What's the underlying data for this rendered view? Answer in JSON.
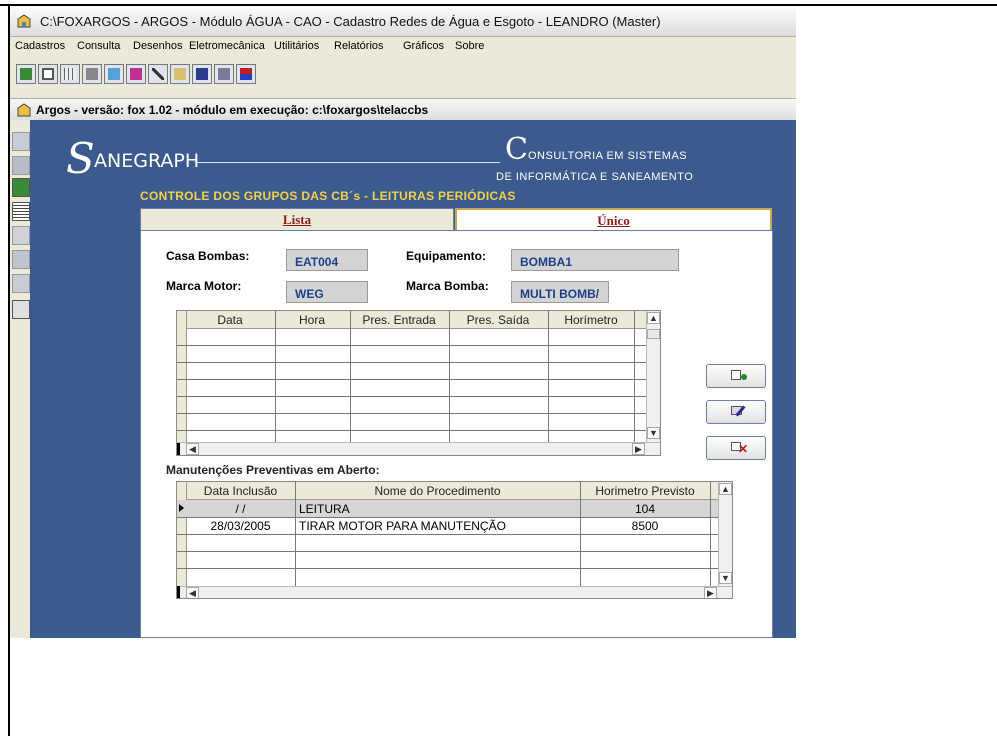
{
  "window": {
    "title": "C:\\FOXARGOS - ARGOS - Módulo ÁGUA - CAO - Cadastro Redes de Água e Esgoto - LEANDRO (Master)"
  },
  "menu": [
    "Cadastros",
    "Consulta",
    "Desenhos",
    "Eletromecânica",
    "Utilitários",
    "Relatórios",
    "Gráficos",
    "Sobre"
  ],
  "toolbar_icons": [
    "exit-icon",
    "form-icon",
    "table-icon",
    "edit-icon",
    "screen-icon",
    "window-icon",
    "tools-icon",
    "copy-icon",
    "save-icon",
    "report-icon",
    "sort-icon"
  ],
  "subbar": {
    "text": "Argos - versão: fox 1.02 - módulo em execução: c:\\foxargos\\telaccbs"
  },
  "side_icons": [
    "new-record-icon",
    "disk-icon",
    "exit-icon",
    "list-icon",
    "delete-icon",
    "undo-icon",
    "approve-icon",
    "print-icon"
  ],
  "logo": {
    "s": "S",
    "name": "ANEGRAPH",
    "c": "C",
    "line1": "ONSULTORIA EM SISTEMAS",
    "line2": "DE INFORMÁTICA E SANEAMENTO"
  },
  "heading": "CONTROLE DOS GRUPOS DAS CB´s - LEITURAS PERIÓDICAS",
  "tabs": {
    "lista": "Lista",
    "unico": "Único"
  },
  "fields": {
    "casa_bombas_label": "Casa Bombas:",
    "casa_bombas": "EAT004",
    "equipamento_label": "Equipamento:",
    "equipamento": "BOMBA1",
    "marca_motor_label": "Marca Motor:",
    "marca_motor": "WEG",
    "marca_bomba_label": "Marca Bomba:",
    "marca_bomba": "MULTI BOMB/"
  },
  "readings": {
    "columns": [
      "Data",
      "Hora",
      "Pres. Entrada",
      "Pres. Saída",
      "Horímetro"
    ]
  },
  "maint": {
    "title": "Manutenções Preventivas em Aberto:",
    "columns": [
      "Data Inclusão",
      "Nome do Procedimento",
      "Horimetro Previsto"
    ],
    "rows": [
      {
        "date": " / /",
        "proc": "LEITURA",
        "hor": "104"
      },
      {
        "date": "28/03/2005",
        "proc": "TIRAR  MOTOR PARA MANUTENÇÃO",
        "hor": "8500"
      }
    ]
  },
  "colors": {
    "panel": "#3b5a8e",
    "heading": "#f2d14a",
    "tab_text": "#8b1a1a",
    "field_text": "#1c3f8a"
  }
}
